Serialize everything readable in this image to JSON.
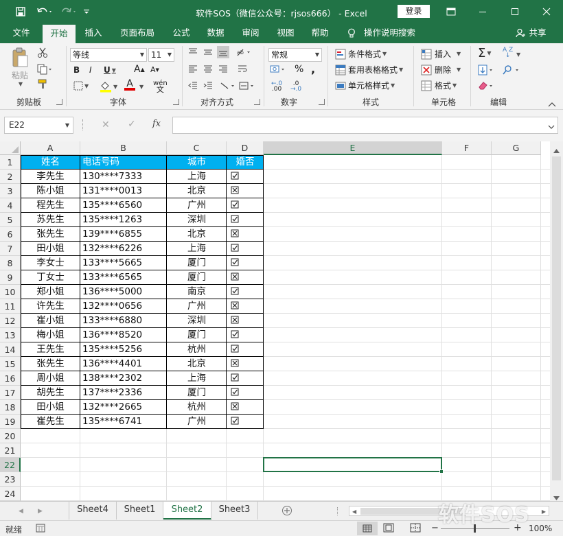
{
  "window": {
    "title": "软件SOS（微信公众号：rjsos666） - Excel",
    "login": "登录"
  },
  "tabs": [
    "文件",
    "开始",
    "插入",
    "页面布局",
    "公式",
    "数据",
    "审阅",
    "视图",
    "帮助",
    "操作说明搜索"
  ],
  "share": "共享",
  "ribbon": {
    "clipboard": {
      "label": "剪贴板",
      "paste": "粘贴"
    },
    "font": {
      "label": "字体",
      "name": "等线",
      "size": "11",
      "bold": "B",
      "italic": "I",
      "underline": "U",
      "grow": "A",
      "shrink": "A",
      "color_a": "A",
      "wen": "wén"
    },
    "align": {
      "label": "对齐方式"
    },
    "number": {
      "label": "数字",
      "format": "常规",
      "percent": "%",
      "comma": ",",
      "inc": ".00",
      "dec": ".0"
    },
    "styles": {
      "label": "样式",
      "conditional": "条件格式",
      "table": "套用表格格式",
      "cell": "单元格样式"
    },
    "cells": {
      "label": "单元格",
      "insert": "插入",
      "delete": "删除",
      "format": "格式"
    },
    "editing": {
      "label": "编辑",
      "sigma": "Σ",
      "sort": "A Z"
    }
  },
  "formula_bar": {
    "name_box": "E22",
    "fx": "fx",
    "cancel": "✕",
    "enter": "✓",
    "value": ""
  },
  "columns": [
    "A",
    "B",
    "C",
    "D",
    "E",
    "F",
    "G"
  ],
  "rows": [
    "1",
    "2",
    "3",
    "4",
    "5",
    "6",
    "7",
    "8",
    "9",
    "10",
    "11",
    "12",
    "13",
    "14",
    "15",
    "16",
    "17",
    "18",
    "19",
    "20",
    "21",
    "22",
    "23",
    "24"
  ],
  "table": {
    "headers": [
      "姓名",
      "电话号码",
      "城市",
      "婚否"
    ],
    "records": [
      {
        "name": "李先生",
        "phone": "130****7333",
        "city": "上海",
        "married": true
      },
      {
        "name": "陈小姐",
        "phone": "131****0013",
        "city": "北京",
        "married": false
      },
      {
        "name": "程先生",
        "phone": "135****6560",
        "city": "广州",
        "married": true
      },
      {
        "name": "苏先生",
        "phone": "135****1263",
        "city": "深圳",
        "married": true
      },
      {
        "name": "张先生",
        "phone": "139****6855",
        "city": "北京",
        "married": false
      },
      {
        "name": "田小姐",
        "phone": "132****6226",
        "city": "上海",
        "married": true
      },
      {
        "name": "李女士",
        "phone": "133****5665",
        "city": "厦门",
        "married": true
      },
      {
        "name": "丁女士",
        "phone": "133****6565",
        "city": "厦门",
        "married": false
      },
      {
        "name": "郑小姐",
        "phone": "136****5000",
        "city": "南京",
        "married": true
      },
      {
        "name": "许先生",
        "phone": "132****0656",
        "city": "广州",
        "married": false
      },
      {
        "name": "崔小姐",
        "phone": "133****6880",
        "city": "深圳",
        "married": false
      },
      {
        "name": "梅小姐",
        "phone": "136****8520",
        "city": "厦门",
        "married": true
      },
      {
        "name": "王先生",
        "phone": "135****5256",
        "city": "杭州",
        "married": true
      },
      {
        "name": "张先生",
        "phone": "136****4401",
        "city": "北京",
        "married": false
      },
      {
        "name": "周小姐",
        "phone": "138****2302",
        "city": "上海",
        "married": true
      },
      {
        "name": "胡先生",
        "phone": "137****2336",
        "city": "厦门",
        "married": true
      },
      {
        "name": "田小姐",
        "phone": "132****2665",
        "city": "杭州",
        "married": false
      },
      {
        "name": "崔先生",
        "phone": "135****6741",
        "city": "广州",
        "married": true
      }
    ]
  },
  "sheets": [
    "Sheet4",
    "Sheet1",
    "Sheet2",
    "Sheet3"
  ],
  "active_sheet": "Sheet2",
  "status": {
    "ready": "就绪",
    "zoom": "100%"
  },
  "watermark": "软件SOS",
  "colors": {
    "accent": "#217346",
    "header_fill": "#00b0f0"
  }
}
